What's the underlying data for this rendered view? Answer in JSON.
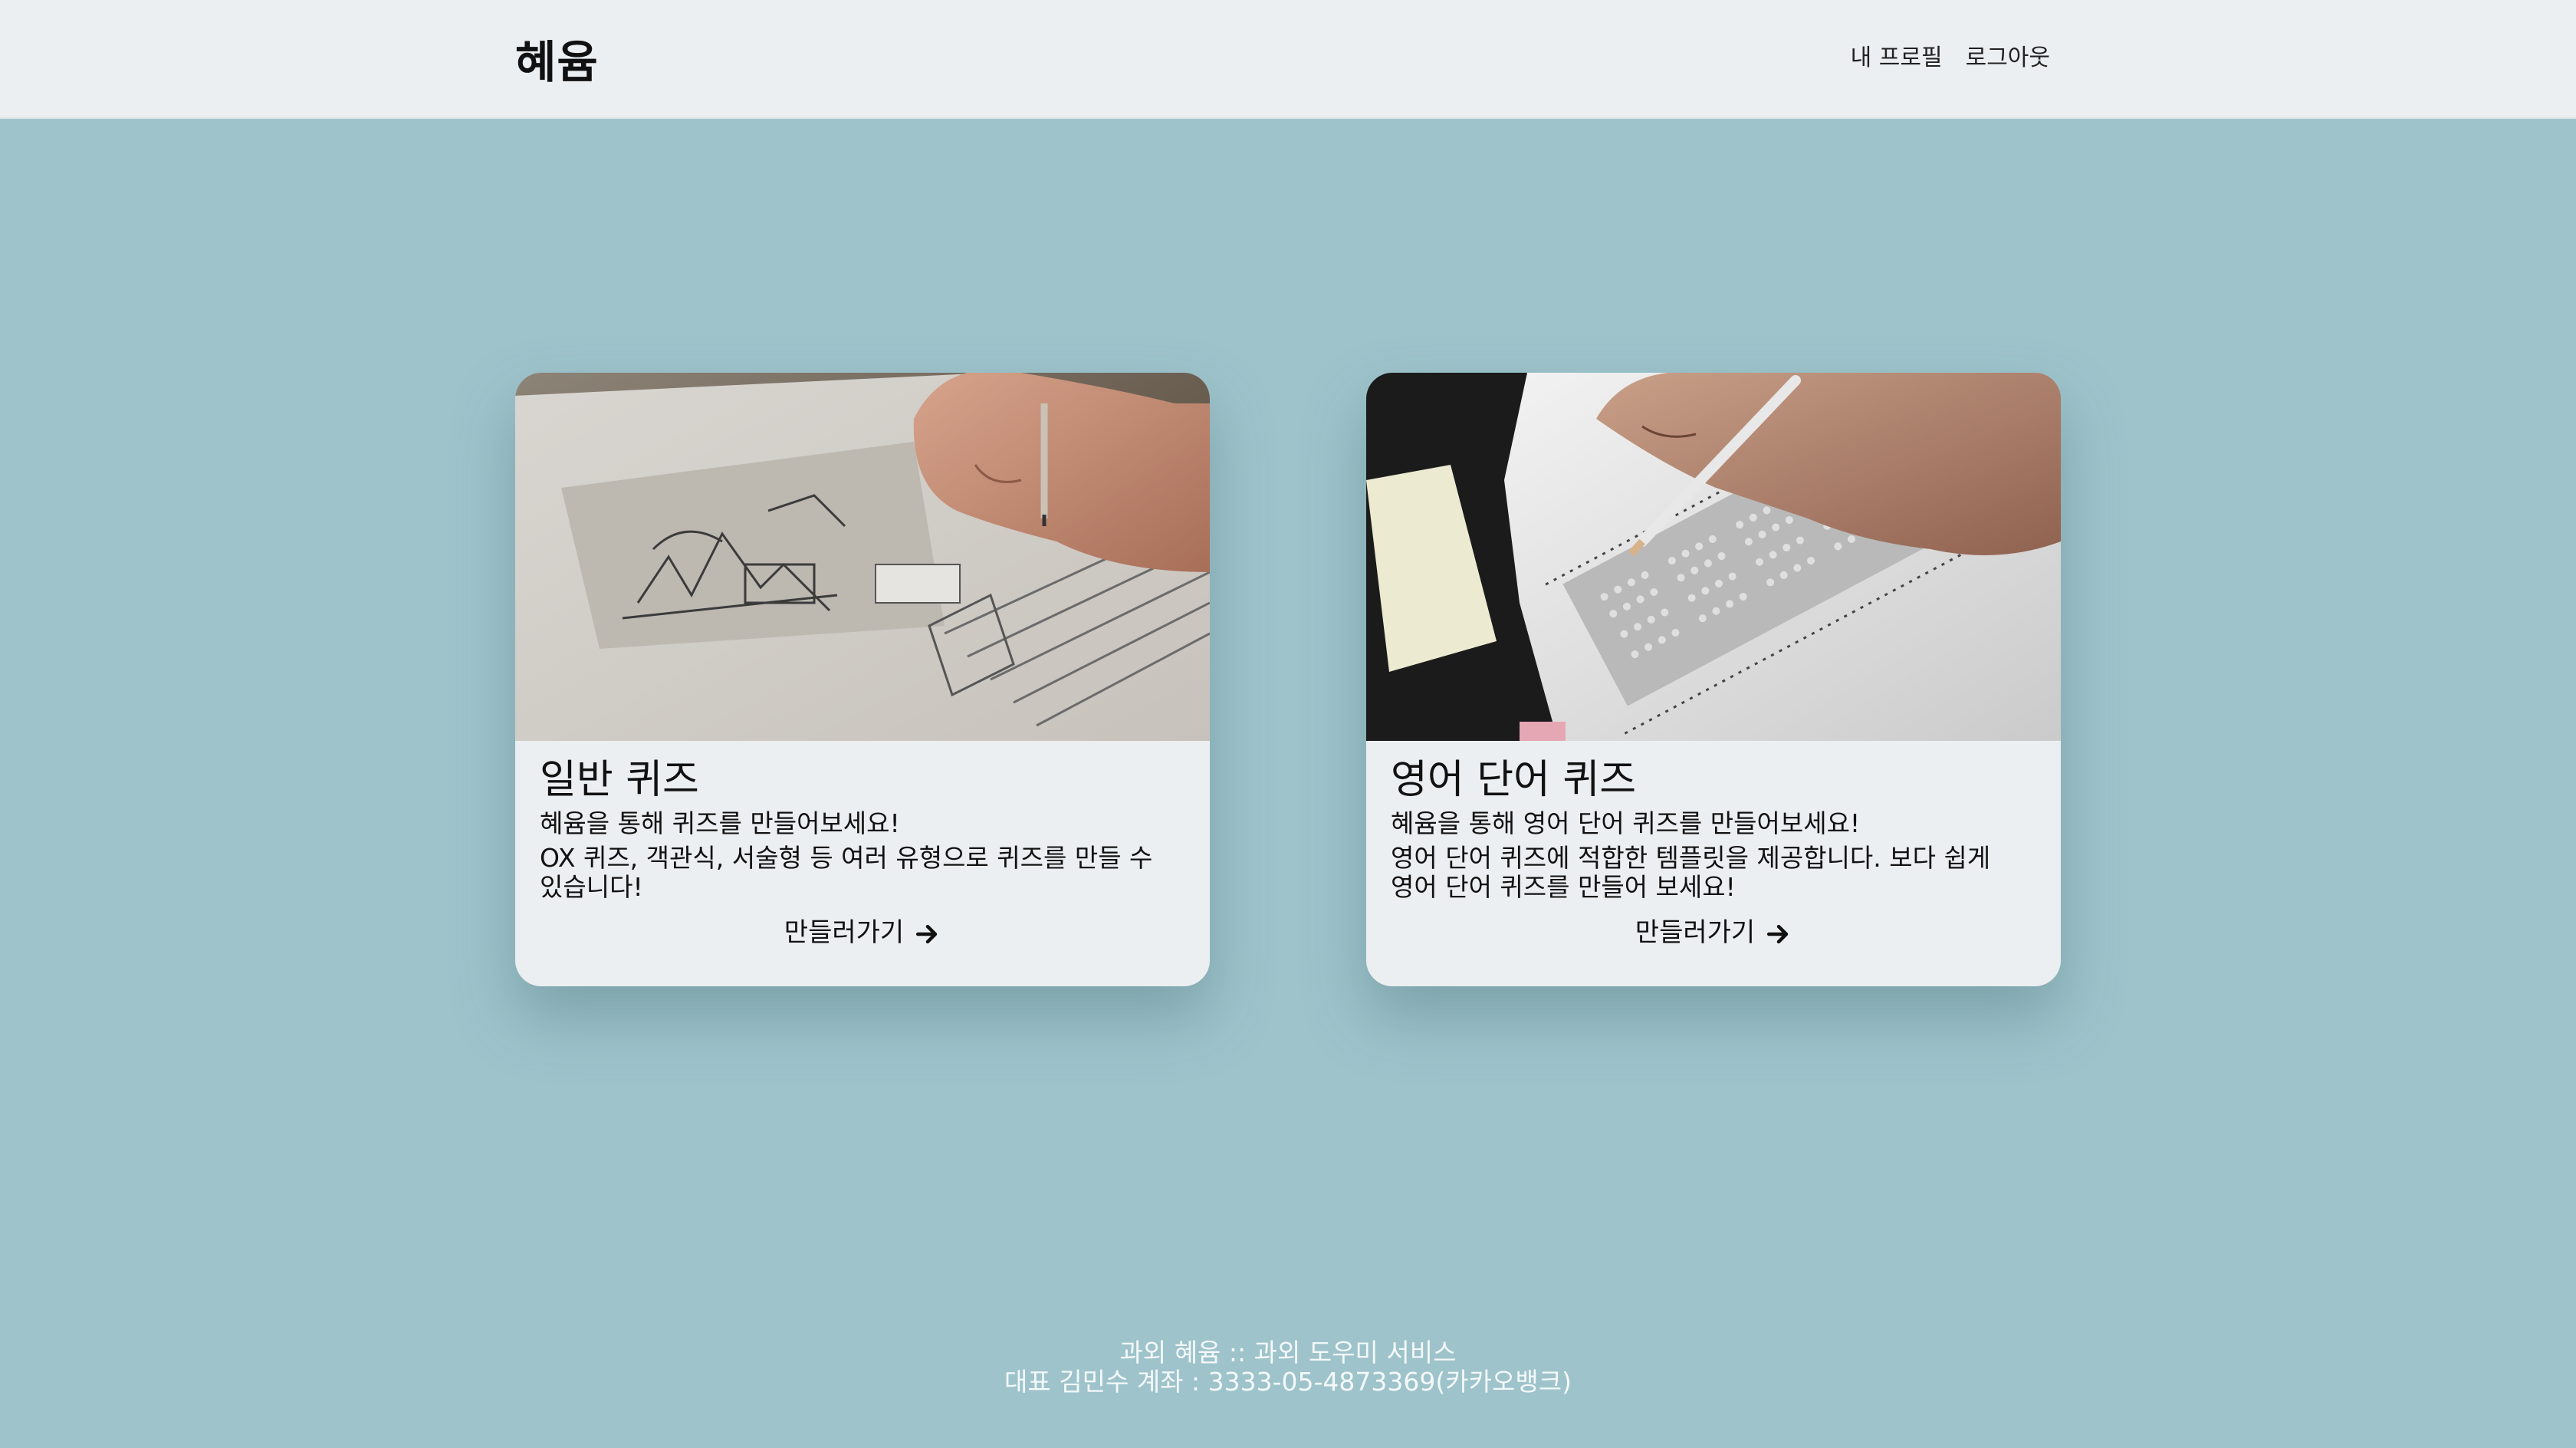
{
  "header": {
    "brand": "혜윰",
    "nav": {
      "profile": "내 프로필",
      "logout": "로그아웃"
    }
  },
  "cards": [
    {
      "title": "일반 퀴즈",
      "subtitle": "혜윰을 통해 퀴즈를 만들어보세요!",
      "description": "OX 퀴즈, 객관식, 서술형 등 여러 유형으로 퀴즈를 만들 수 있습니다!",
      "cta": "만들러가기",
      "image": "student-writing-worksheet-photo"
    },
    {
      "title": "영어 단어 퀴즈",
      "subtitle": "혜윰을 통해 영어 단어 퀴즈를 만들어보세요!",
      "description": "영어 단어 퀴즈에 적합한 템플릿을 제공합니다. 보다 쉽게 영어 단어 퀴즈를 만들어 보세요!",
      "cta": "만들러가기",
      "image": "omr-answer-sheet-photo"
    }
  ],
  "footer": {
    "line1": "과외 혜윰 :: 과외 도우미 서비스",
    "line2": "대표 김민수 계좌 : 3333-05-4873369(카카오뱅크)"
  },
  "colors": {
    "background": "#9ec3cb",
    "navbar": "#eceff1",
    "card": "#eceff1"
  },
  "icons": {
    "cta": "arrow-right-icon"
  }
}
